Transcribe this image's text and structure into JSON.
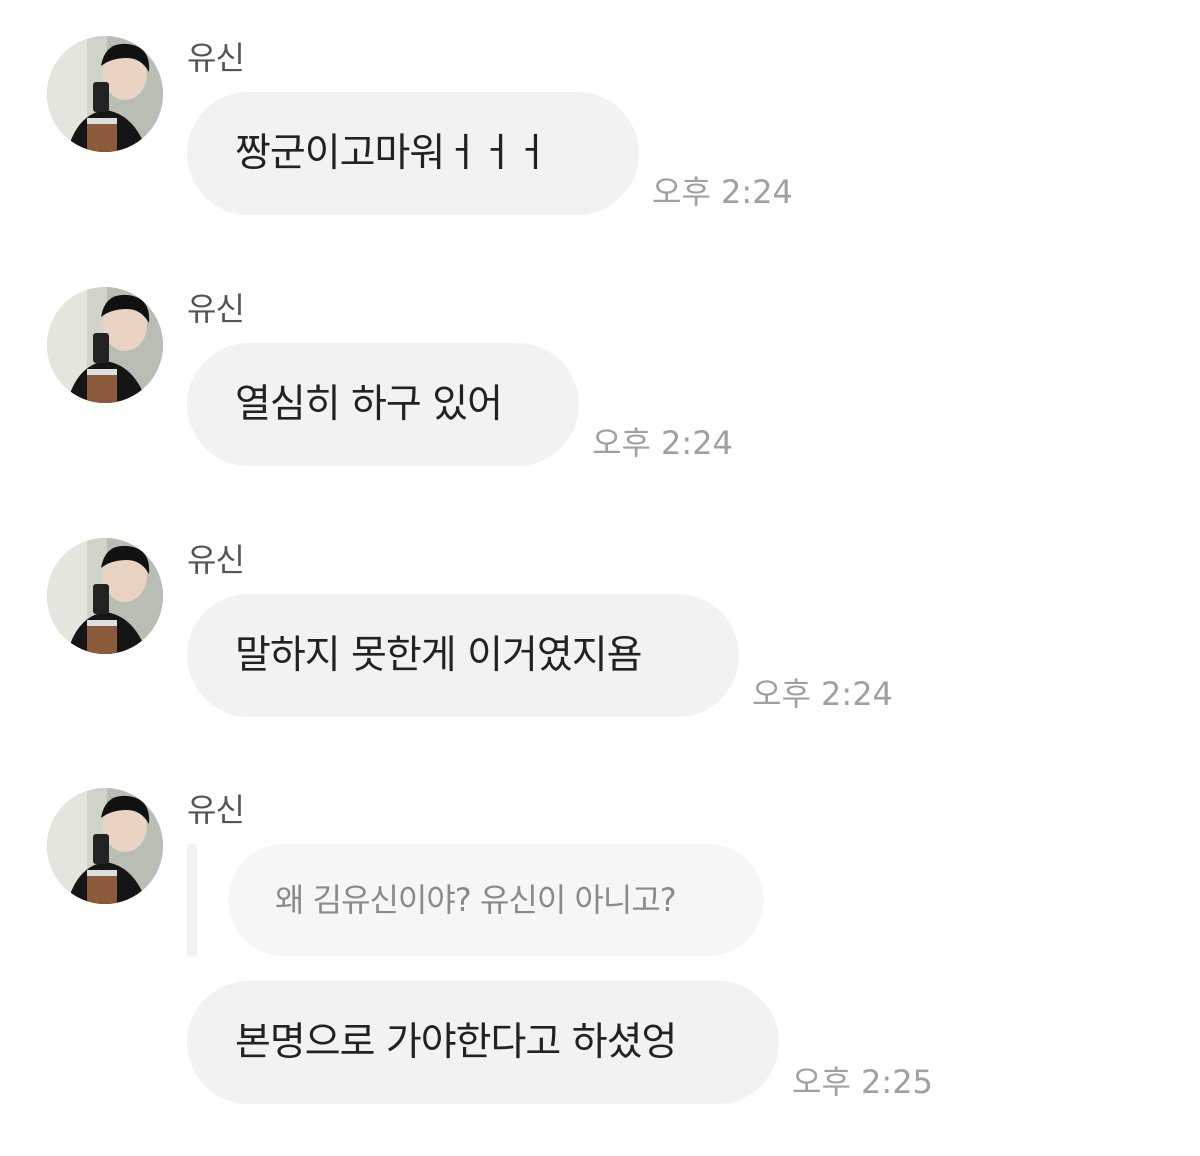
{
  "messages": [
    {
      "sender": "유신",
      "text": "짱군이고마워ㅓㅓㅓ",
      "time": "오후 2:24",
      "avatar": "profile-photo"
    },
    {
      "sender": "유신",
      "text": "열심히 하구 있어",
      "time": "오후 2:24",
      "avatar": "profile-photo"
    },
    {
      "sender": "유신",
      "text": "말하지 못한게 이거였지욤",
      "time": "오후 2:24",
      "avatar": "profile-photo"
    },
    {
      "sender": "유신",
      "reply_to": "왜 김유신이야? 유신이 아니고?",
      "text": "본명으로 가야한다고 하셨엉",
      "time": "오후 2:25",
      "avatar": "profile-photo"
    }
  ],
  "colors": {
    "background": "#ffffff",
    "bubble": "#f2f2f4",
    "quote_bubble": "#f6f6f8",
    "text": "#222222",
    "sender": "#555555",
    "time": "#a0a0a0"
  }
}
